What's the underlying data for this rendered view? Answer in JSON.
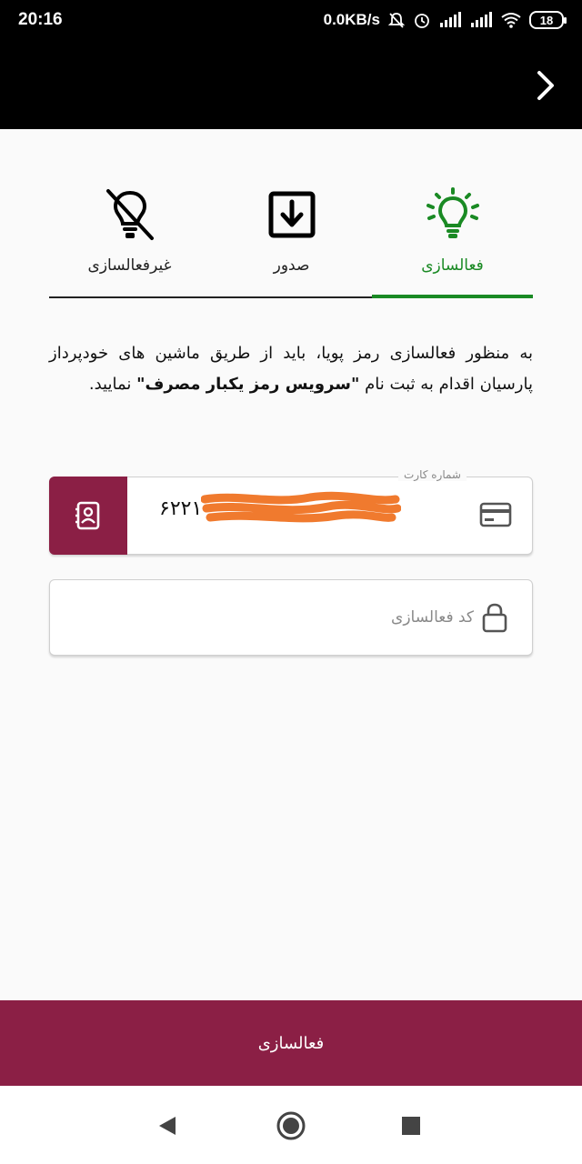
{
  "status_bar": {
    "time": "20:16",
    "network_speed": "0.0KB/s",
    "battery": "18"
  },
  "tabs": [
    {
      "label": "فعالسازی",
      "icon": "lightbulb-on-icon",
      "active": true
    },
    {
      "label": "صدور",
      "icon": "download-box-icon",
      "active": false
    },
    {
      "label": "غیرفعالسازی",
      "icon": "lightbulb-off-icon",
      "active": false
    }
  ],
  "description": {
    "part1": "به منظور فعالسازی رمز پویا، باید از طریق ماشین های خودپرداز پارسیان اقدام به ثبت نام ",
    "bold": "\"سرویس رمز یکبار مصرف\"",
    "part2": " نمایید."
  },
  "card_field": {
    "label": "شماره کارت",
    "value": "۶۲۲۱ - ",
    "icon": "credit-card-icon",
    "button_icon": "contact-book-icon"
  },
  "code_field": {
    "placeholder": "کد فعالسازی",
    "icon": "lock-icon"
  },
  "submit": {
    "label": "فعالسازی"
  },
  "colors": {
    "accent": "#8b1f45",
    "active_tab": "#1a8a24"
  }
}
